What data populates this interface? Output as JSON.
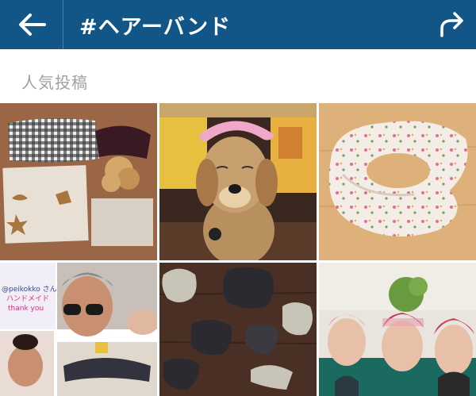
{
  "header": {
    "title": "#ヘアーバンド",
    "background": "#125688",
    "back_icon": "arrow-left-icon",
    "share_icon": "share-arrow-icon"
  },
  "section": {
    "label": "人気投稿"
  },
  "posts": [
    {
      "id_label": "post-1",
      "description": "gingham headband with cookies"
    },
    {
      "id_label": "post-2",
      "description": "dog wearing pink headband"
    },
    {
      "id_label": "post-3",
      "description": "floral infinity scarf"
    },
    {
      "id_label": "post-4",
      "description": "peikokko handmade collage",
      "caption_line1": "@peikokko さん",
      "caption_line2": "ハンドメイド",
      "caption_line3": "thank you"
    },
    {
      "id_label": "post-5",
      "description": "knit bow headbands"
    },
    {
      "id_label": "post-6",
      "description": "three women in knit headbands"
    }
  ]
}
